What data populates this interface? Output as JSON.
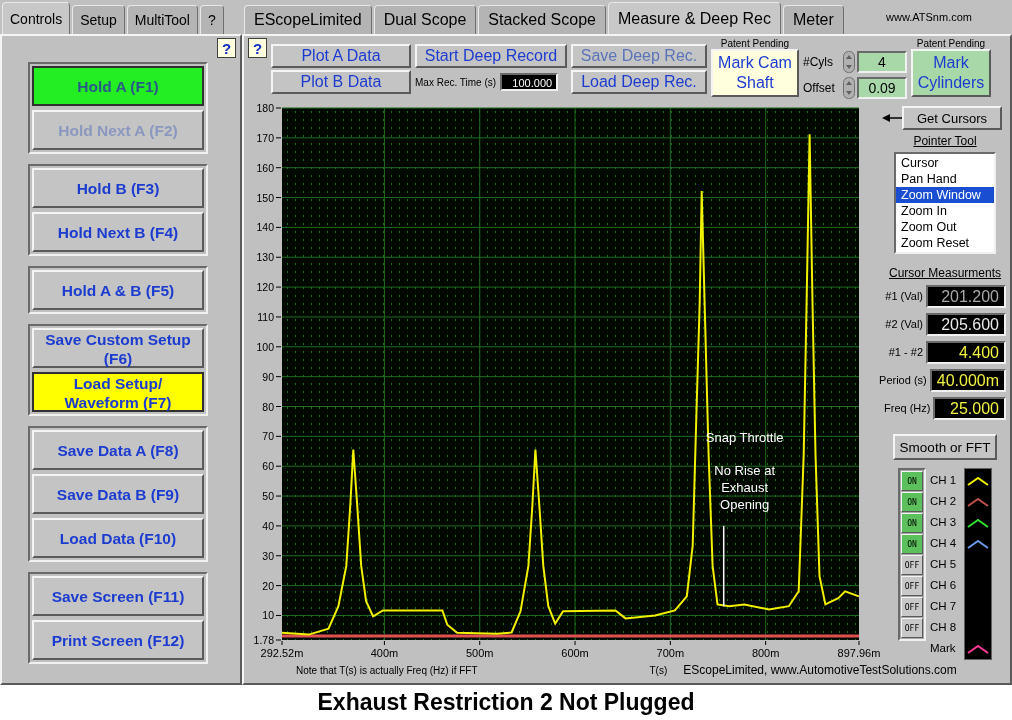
{
  "left_tabs": [
    {
      "label": "Controls",
      "selected": true
    },
    {
      "label": "Setup",
      "selected": false
    },
    {
      "label": "MultiTool",
      "selected": false
    },
    {
      "label": "?",
      "selected": false
    }
  ],
  "left_help": "?",
  "control_groups": [
    {
      "buttons": [
        {
          "label": "Hold A (F1)",
          "on": true,
          "disabled": false,
          "highlighted": false
        },
        {
          "label": "Hold Next A (F2)",
          "on": false,
          "disabled": true,
          "highlighted": false
        }
      ]
    },
    {
      "buttons": [
        {
          "label": "Hold B (F3)",
          "on": false,
          "disabled": false,
          "highlighted": false
        },
        {
          "label": "Hold Next B (F4)",
          "on": false,
          "disabled": false,
          "highlighted": false
        }
      ]
    },
    {
      "buttons": [
        {
          "label": "Hold A & B (F5)",
          "on": false,
          "disabled": false,
          "highlighted": false
        }
      ]
    },
    {
      "buttons": [
        {
          "label": "Save Custom Setup (F6)",
          "on": false,
          "disabled": false,
          "highlighted": false
        },
        {
          "label": "Load Setup/ Waveform (F7)",
          "on": false,
          "disabled": false,
          "highlighted": true
        }
      ]
    },
    {
      "buttons": [
        {
          "label": "Save Data A (F8)",
          "on": false,
          "disabled": false,
          "highlighted": false
        },
        {
          "label": "Save Data B (F9)",
          "on": false,
          "disabled": false,
          "highlighted": false
        },
        {
          "label": "Load Data (F10)",
          "on": false,
          "disabled": false,
          "highlighted": false
        }
      ]
    },
    {
      "buttons": [
        {
          "label": "Save Screen (F11)",
          "on": false,
          "disabled": false,
          "highlighted": false
        },
        {
          "label": "Print Screen (F12)",
          "on": false,
          "disabled": false,
          "highlighted": false
        }
      ]
    }
  ],
  "main_tabs": [
    {
      "label": "EScopeLimited",
      "selected": false
    },
    {
      "label": "Dual Scope",
      "selected": false
    },
    {
      "label": "Stacked Scope",
      "selected": false
    },
    {
      "label": "Measure & Deep Rec",
      "selected": true
    },
    {
      "label": "Meter",
      "selected": false
    }
  ],
  "site_label": "www.ATSnm.com",
  "main_help": "?",
  "toolbar": {
    "plot_a": "Plot A Data",
    "plot_b": "Plot B Data",
    "start_deep": "Start Deep Record",
    "max_rec_label": "Max Rec. Time (s)",
    "max_rec_value": "100.000",
    "save_deep": {
      "label": "Save Deep Rec.",
      "disabled": true
    },
    "load_deep": {
      "label": "Load Deep Rec.",
      "disabled": false
    },
    "cam_patent": "Patent Pending",
    "mark_cam": "Mark Cam Shaft",
    "cyls_label": "#Cyls",
    "cyls_value": "4",
    "offset_label": "Offset",
    "offset_value": "0.09",
    "cyl_patent": "Patent Pending",
    "mark_cyl": "Mark Cylinders"
  },
  "chart": {
    "chart_data": {
      "type": "line",
      "xlabel": "T(s)",
      "xlim": [
        292.52,
        897.96
      ],
      "ylim": [
        1.78,
        180
      ],
      "x": [
        292.52,
        320.6,
        341.3,
        351.7,
        360,
        364.2,
        367.3,
        371.4,
        375.6,
        380.8,
        388.1,
        398.4,
        434.8,
        460.8,
        466,
        476.3,
        518,
        533.4,
        542.8,
        551.1,
        555.3,
        558.4,
        562.5,
        566.7,
        571.9,
        579.2,
        587.5,
        642.5,
        652.9,
        684,
        704.8,
        717.3,
        723.5,
        727.7,
        730.8,
        732.9,
        736,
        740.1,
        744.3,
        749.5,
        761.9,
        777.5,
        803.5,
        824.3,
        834.7,
        839.9,
        843,
        846.1,
        849.2,
        852.3,
        856.5,
        862.7,
        876.2,
        883.4,
        897.9
      ],
      "series": [
        {
          "color": "#f0f000",
          "values": [
            4.2,
            3.6,
            5.6,
            13.1,
            26.6,
            47.0,
            65.6,
            47.0,
            26.6,
            14.8,
            9.7,
            11.7,
            11.7,
            11.7,
            6.9,
            4.2,
            3.9,
            4.3,
            11.4,
            26.6,
            47.0,
            65.6,
            47.0,
            26.6,
            13.1,
            7.3,
            11.4,
            11.7,
            9.0,
            10.0,
            11.7,
            16.4,
            33.4,
            80.9,
            114.8,
            152.2,
            114.8,
            63.9,
            26.6,
            13.7,
            13.1,
            13.7,
            12.0,
            13.1,
            18.1,
            63.9,
            114.8,
            171.2,
            114.8,
            63.9,
            23.2,
            13.7,
            15.8,
            18.1,
            16.4
          ]
        }
      ],
      "xticks": [
        {
          "value": 292.52,
          "label": "292.52m"
        },
        {
          "value": 400,
          "label": "400m"
        },
        {
          "value": 500,
          "label": "500m"
        },
        {
          "value": 600,
          "label": "600m"
        },
        {
          "value": 700,
          "label": "700m"
        },
        {
          "value": 800,
          "label": "800m"
        },
        {
          "value": 897.96,
          "label": "897.96m"
        }
      ],
      "yticks": [
        1.78,
        10,
        20,
        30,
        40,
        50,
        60,
        70,
        80,
        90,
        100,
        110,
        120,
        130,
        140,
        150,
        160,
        170,
        180
      ],
      "annotations": [
        "Snap Throttle",
        "No Rise at Exhaust Opening"
      ],
      "ref_lines": [
        {
          "axis": "y",
          "value": 3.1,
          "color": "#e05050"
        }
      ],
      "grid": true
    },
    "note": "Note that T(s) is actually Freq (Hz) if FFT",
    "credit": "EScopeLimited, www.AutomotiveTestSolutions.com"
  },
  "side": {
    "get_cursors": "Get Cursors",
    "pointer_title": "Pointer Tool",
    "pointer_items": [
      {
        "label": "Cursor",
        "selected": false
      },
      {
        "label": "Pan Hand",
        "selected": false
      },
      {
        "label": "Zoom Window",
        "selected": true
      },
      {
        "label": "Zoom In",
        "selected": false
      },
      {
        "label": "Zoom Out",
        "selected": false
      },
      {
        "label": "Zoom Reset",
        "selected": false
      }
    ],
    "measure_title": "Cursor Measurments",
    "readouts": [
      {
        "label": "#1 (Val)",
        "value": "201.200",
        "kind": "dim"
      },
      {
        "label": "#2 (Val)",
        "value": "205.600",
        "kind": "plain"
      },
      {
        "label": "#1 - #2",
        "value": "4.400",
        "kind": "accent"
      },
      {
        "label": "Period (s)",
        "value": "40.000m",
        "kind": "accent"
      },
      {
        "label": "Freq (Hz)",
        "value": "25.000",
        "kind": "accent"
      }
    ],
    "smooth": "Smooth or FFT",
    "channels": [
      {
        "kind": "channel",
        "label": "CH 1",
        "on": true,
        "toggle": "ON",
        "color": "#f0f000"
      },
      {
        "kind": "channel",
        "label": "CH 2",
        "on": true,
        "toggle": "ON",
        "color": "#c05050"
      },
      {
        "kind": "channel",
        "label": "CH 3",
        "on": true,
        "toggle": "ON",
        "color": "#30e030"
      },
      {
        "kind": "channel",
        "label": "CH 4",
        "on": true,
        "toggle": "ON",
        "color": "#6a9ae8"
      },
      {
        "kind": "channel",
        "label": "CH 5",
        "on": false,
        "toggle": "OFF"
      },
      {
        "kind": "channel",
        "label": "CH 6",
        "on": false,
        "toggle": "OFF"
      },
      {
        "kind": "channel",
        "label": "CH 7",
        "on": false,
        "toggle": "OFF"
      },
      {
        "kind": "channel",
        "label": "CH 8",
        "on": false,
        "toggle": "OFF"
      },
      {
        "kind": "mark",
        "label": "Mark",
        "color": "#ff3c9a"
      }
    ]
  },
  "caption": "Exhaust Restriction 2 Not Plugged"
}
